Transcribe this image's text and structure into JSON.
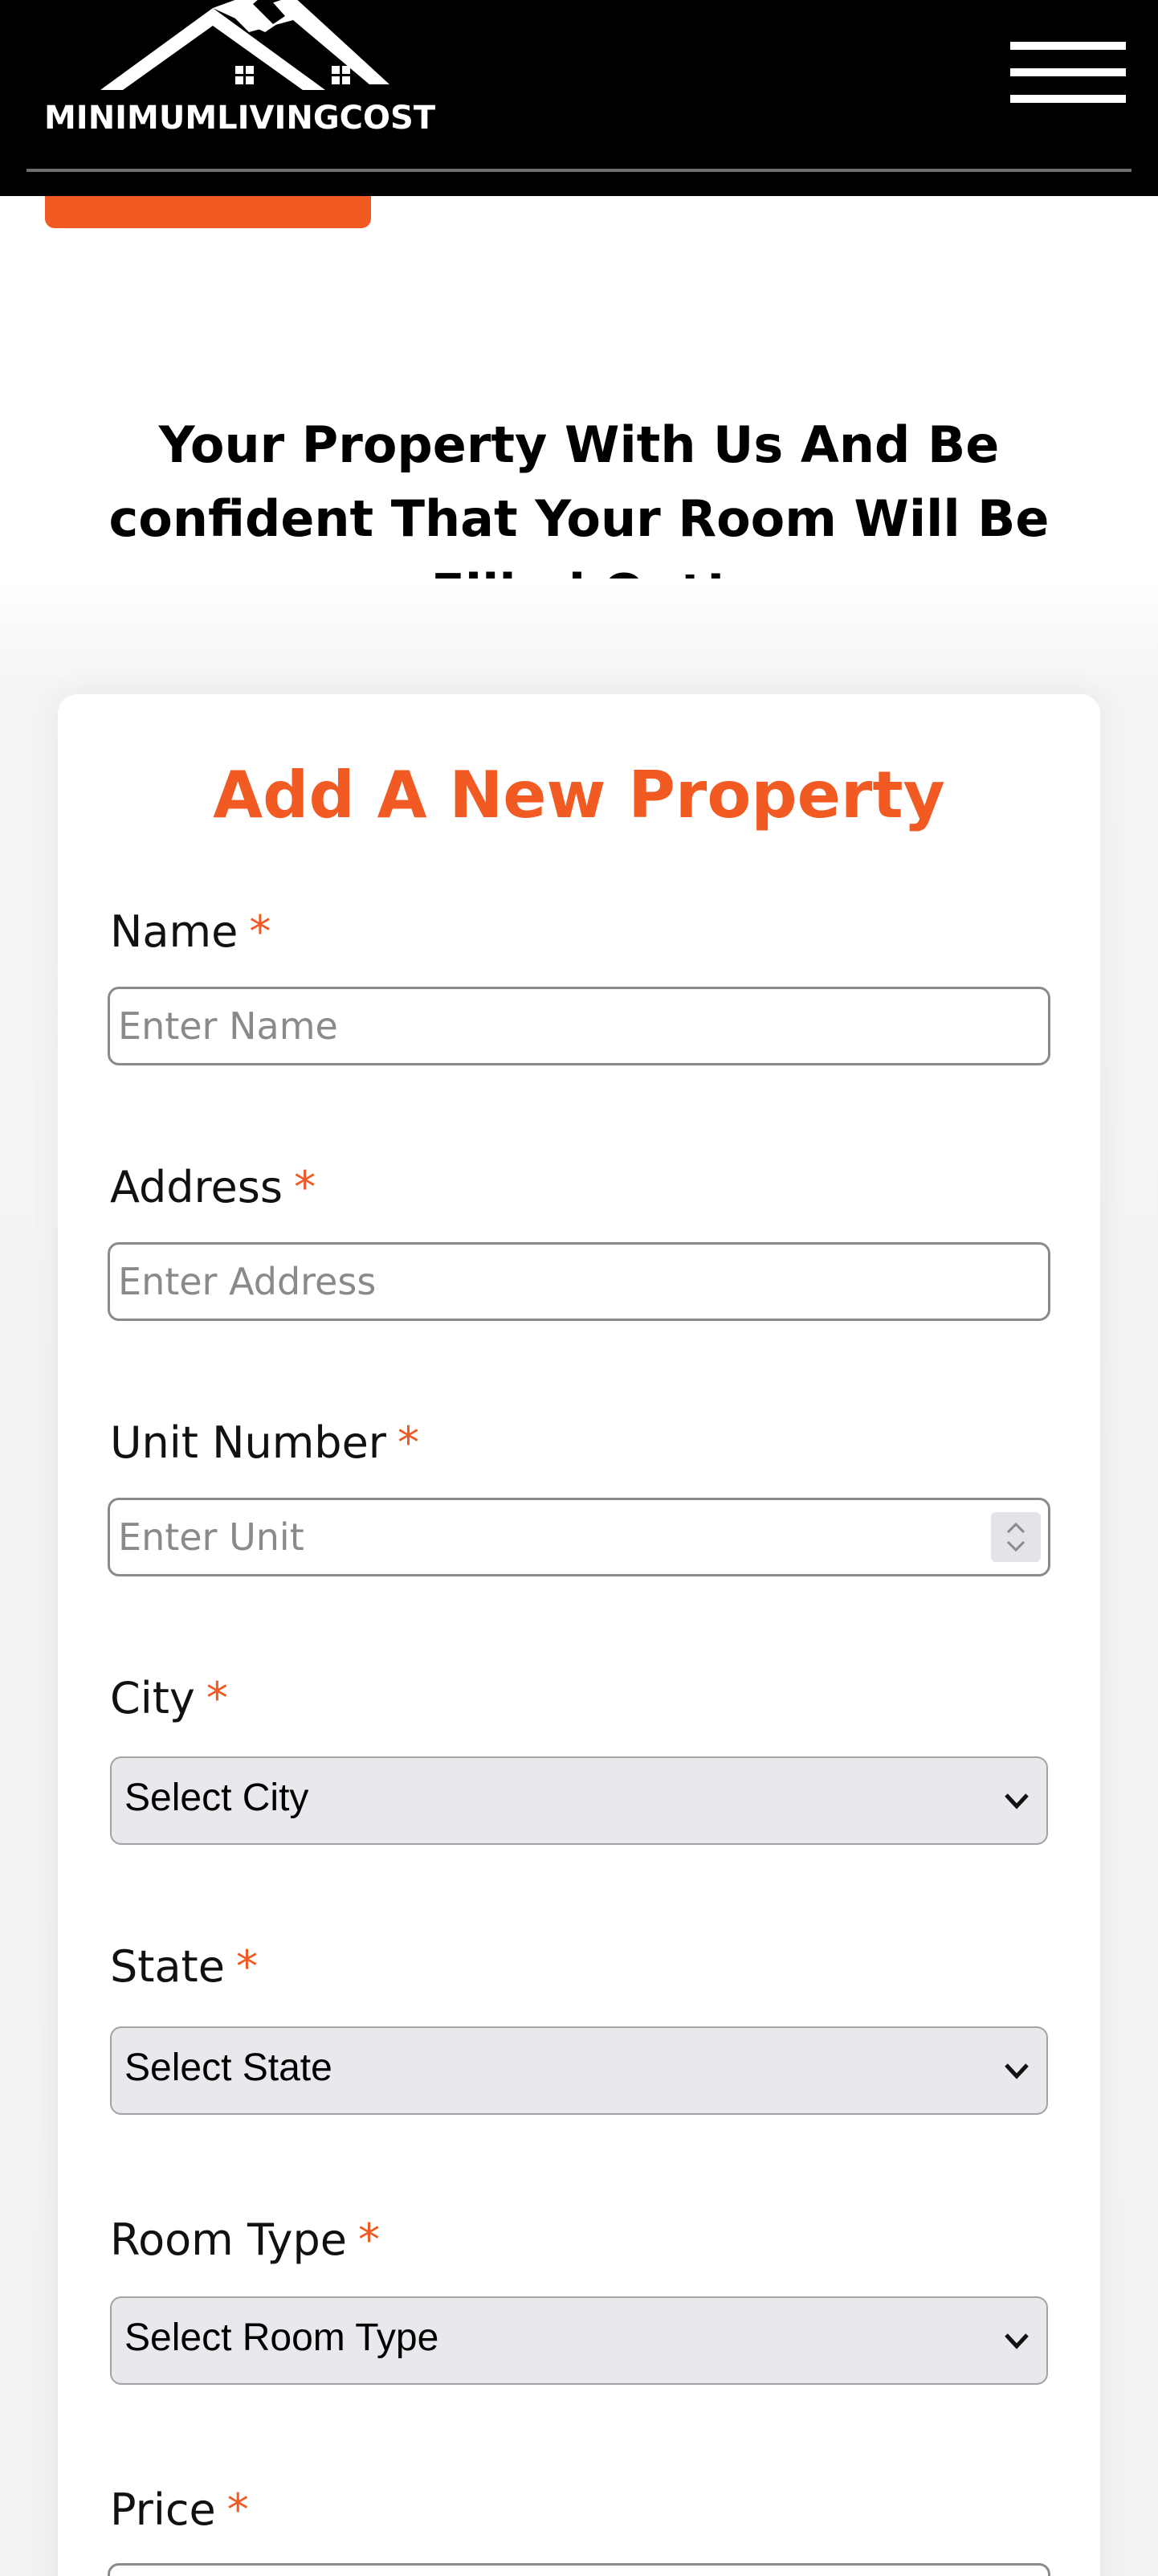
{
  "header": {
    "brand": "MINIMUMLIVINGCOST",
    "menu_icon": "hamburger-menu-icon"
  },
  "hero": {
    "tagline": "Your Property With Us And Be confident That Your Room Will Be Filled Out!"
  },
  "form": {
    "title": "Add A New Property",
    "required_mark": "*",
    "name": {
      "label": "Name",
      "placeholder": "Enter Name"
    },
    "address": {
      "label": "Address",
      "placeholder": "Enter Address"
    },
    "unit": {
      "label": "Unit Number",
      "placeholder": "Enter Unit"
    },
    "city": {
      "label": "City",
      "selected": "Select City"
    },
    "state": {
      "label": "State",
      "selected": "Select State"
    },
    "room_type": {
      "label": "Room Type",
      "selected": "Select Room Type"
    },
    "price": {
      "label": "Price"
    }
  },
  "colors": {
    "accent": "#f15a22",
    "header_bg": "#000000",
    "select_bg": "#e8e8ed"
  }
}
